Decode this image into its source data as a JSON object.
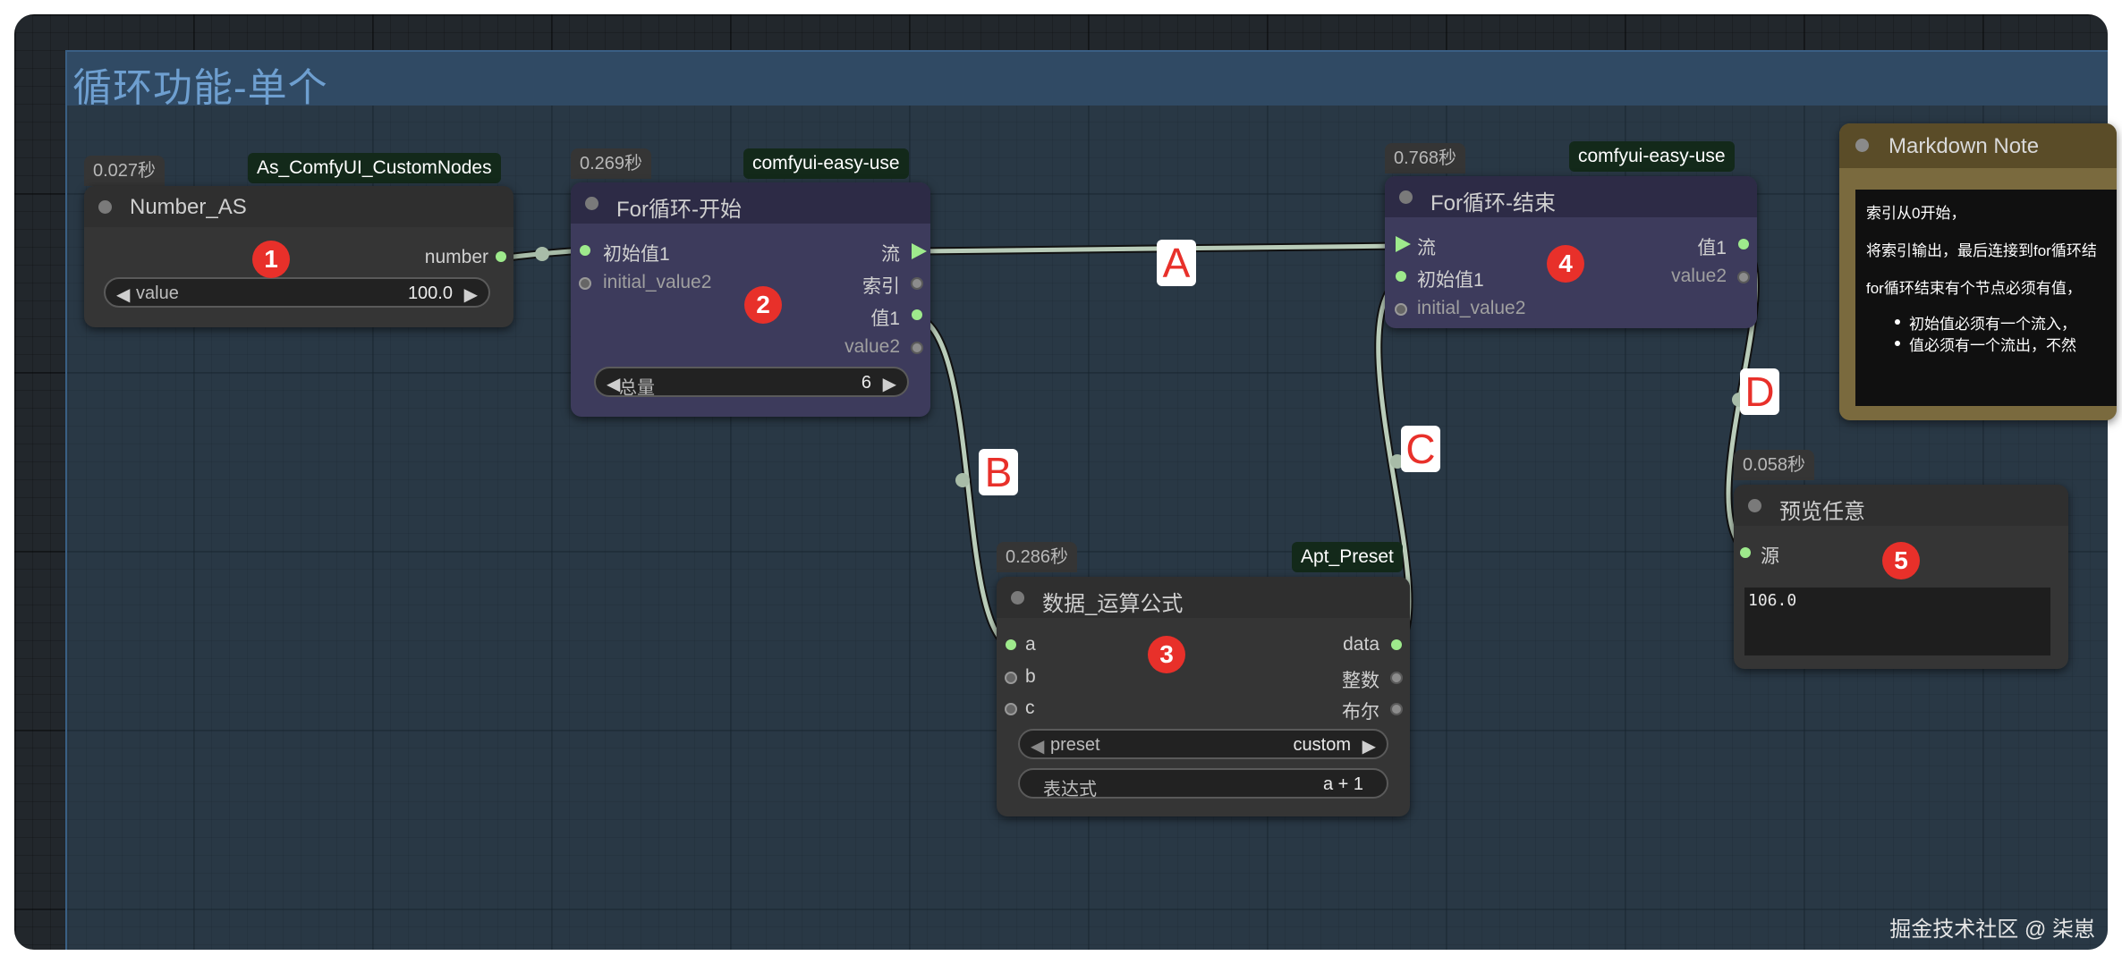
{
  "group": {
    "title": "循环功能-单个"
  },
  "nodes": {
    "number_as": {
      "time": "0.027秒",
      "badge": "As_ComfyUI_CustomNodes",
      "title": "Number_AS",
      "output": "number",
      "widget_label": "value",
      "widget_value": "100.0",
      "marker": "1"
    },
    "for_start": {
      "time": "0.269秒",
      "badge": "comfyui-easy-use",
      "title": "For循环-开始",
      "inputs": [
        "初始值1",
        "initial_value2"
      ],
      "outputs": [
        "流",
        "索引",
        "值1",
        "value2"
      ],
      "widget_label": "总量",
      "widget_value": "6",
      "marker": "2"
    },
    "formula": {
      "time": "0.286秒",
      "badge": "Apt_Preset",
      "title": "数据_运算公式",
      "inputs": [
        "a",
        "b",
        "c"
      ],
      "outputs": [
        "data",
        "整数",
        "布尔"
      ],
      "preset_label": "preset",
      "preset_value": "custom",
      "expr_label": "表达式",
      "expr_value": "a + 1",
      "marker": "3"
    },
    "for_end": {
      "time": "0.768秒",
      "badge": "comfyui-easy-use",
      "title": "For循环-结束",
      "inputs": [
        "流",
        "初始值1",
        "initial_value2"
      ],
      "outputs": [
        "值1",
        "value2"
      ],
      "marker": "4"
    },
    "preview": {
      "time": "0.058秒",
      "title": "预览任意",
      "input": "源",
      "text": "106.0",
      "marker": "5"
    },
    "note": {
      "title": "Markdown Note",
      "lines": [
        "索引从0开始，",
        "将索引输出，最后连接到for循环结",
        "for循环结束有个节点必须有值，"
      ],
      "bullets": [
        "初始值必须有一个流入，",
        "值必须有一个流出，不然"
      ]
    }
  },
  "edge_labels": [
    "A",
    "B",
    "C",
    "D"
  ],
  "watermark": "掘金技术社区 @ 柒崽",
  "colors": {
    "accent_green": "#9eea8c",
    "marker_red": "#e8302a",
    "group_title": "#6e9fd0"
  }
}
